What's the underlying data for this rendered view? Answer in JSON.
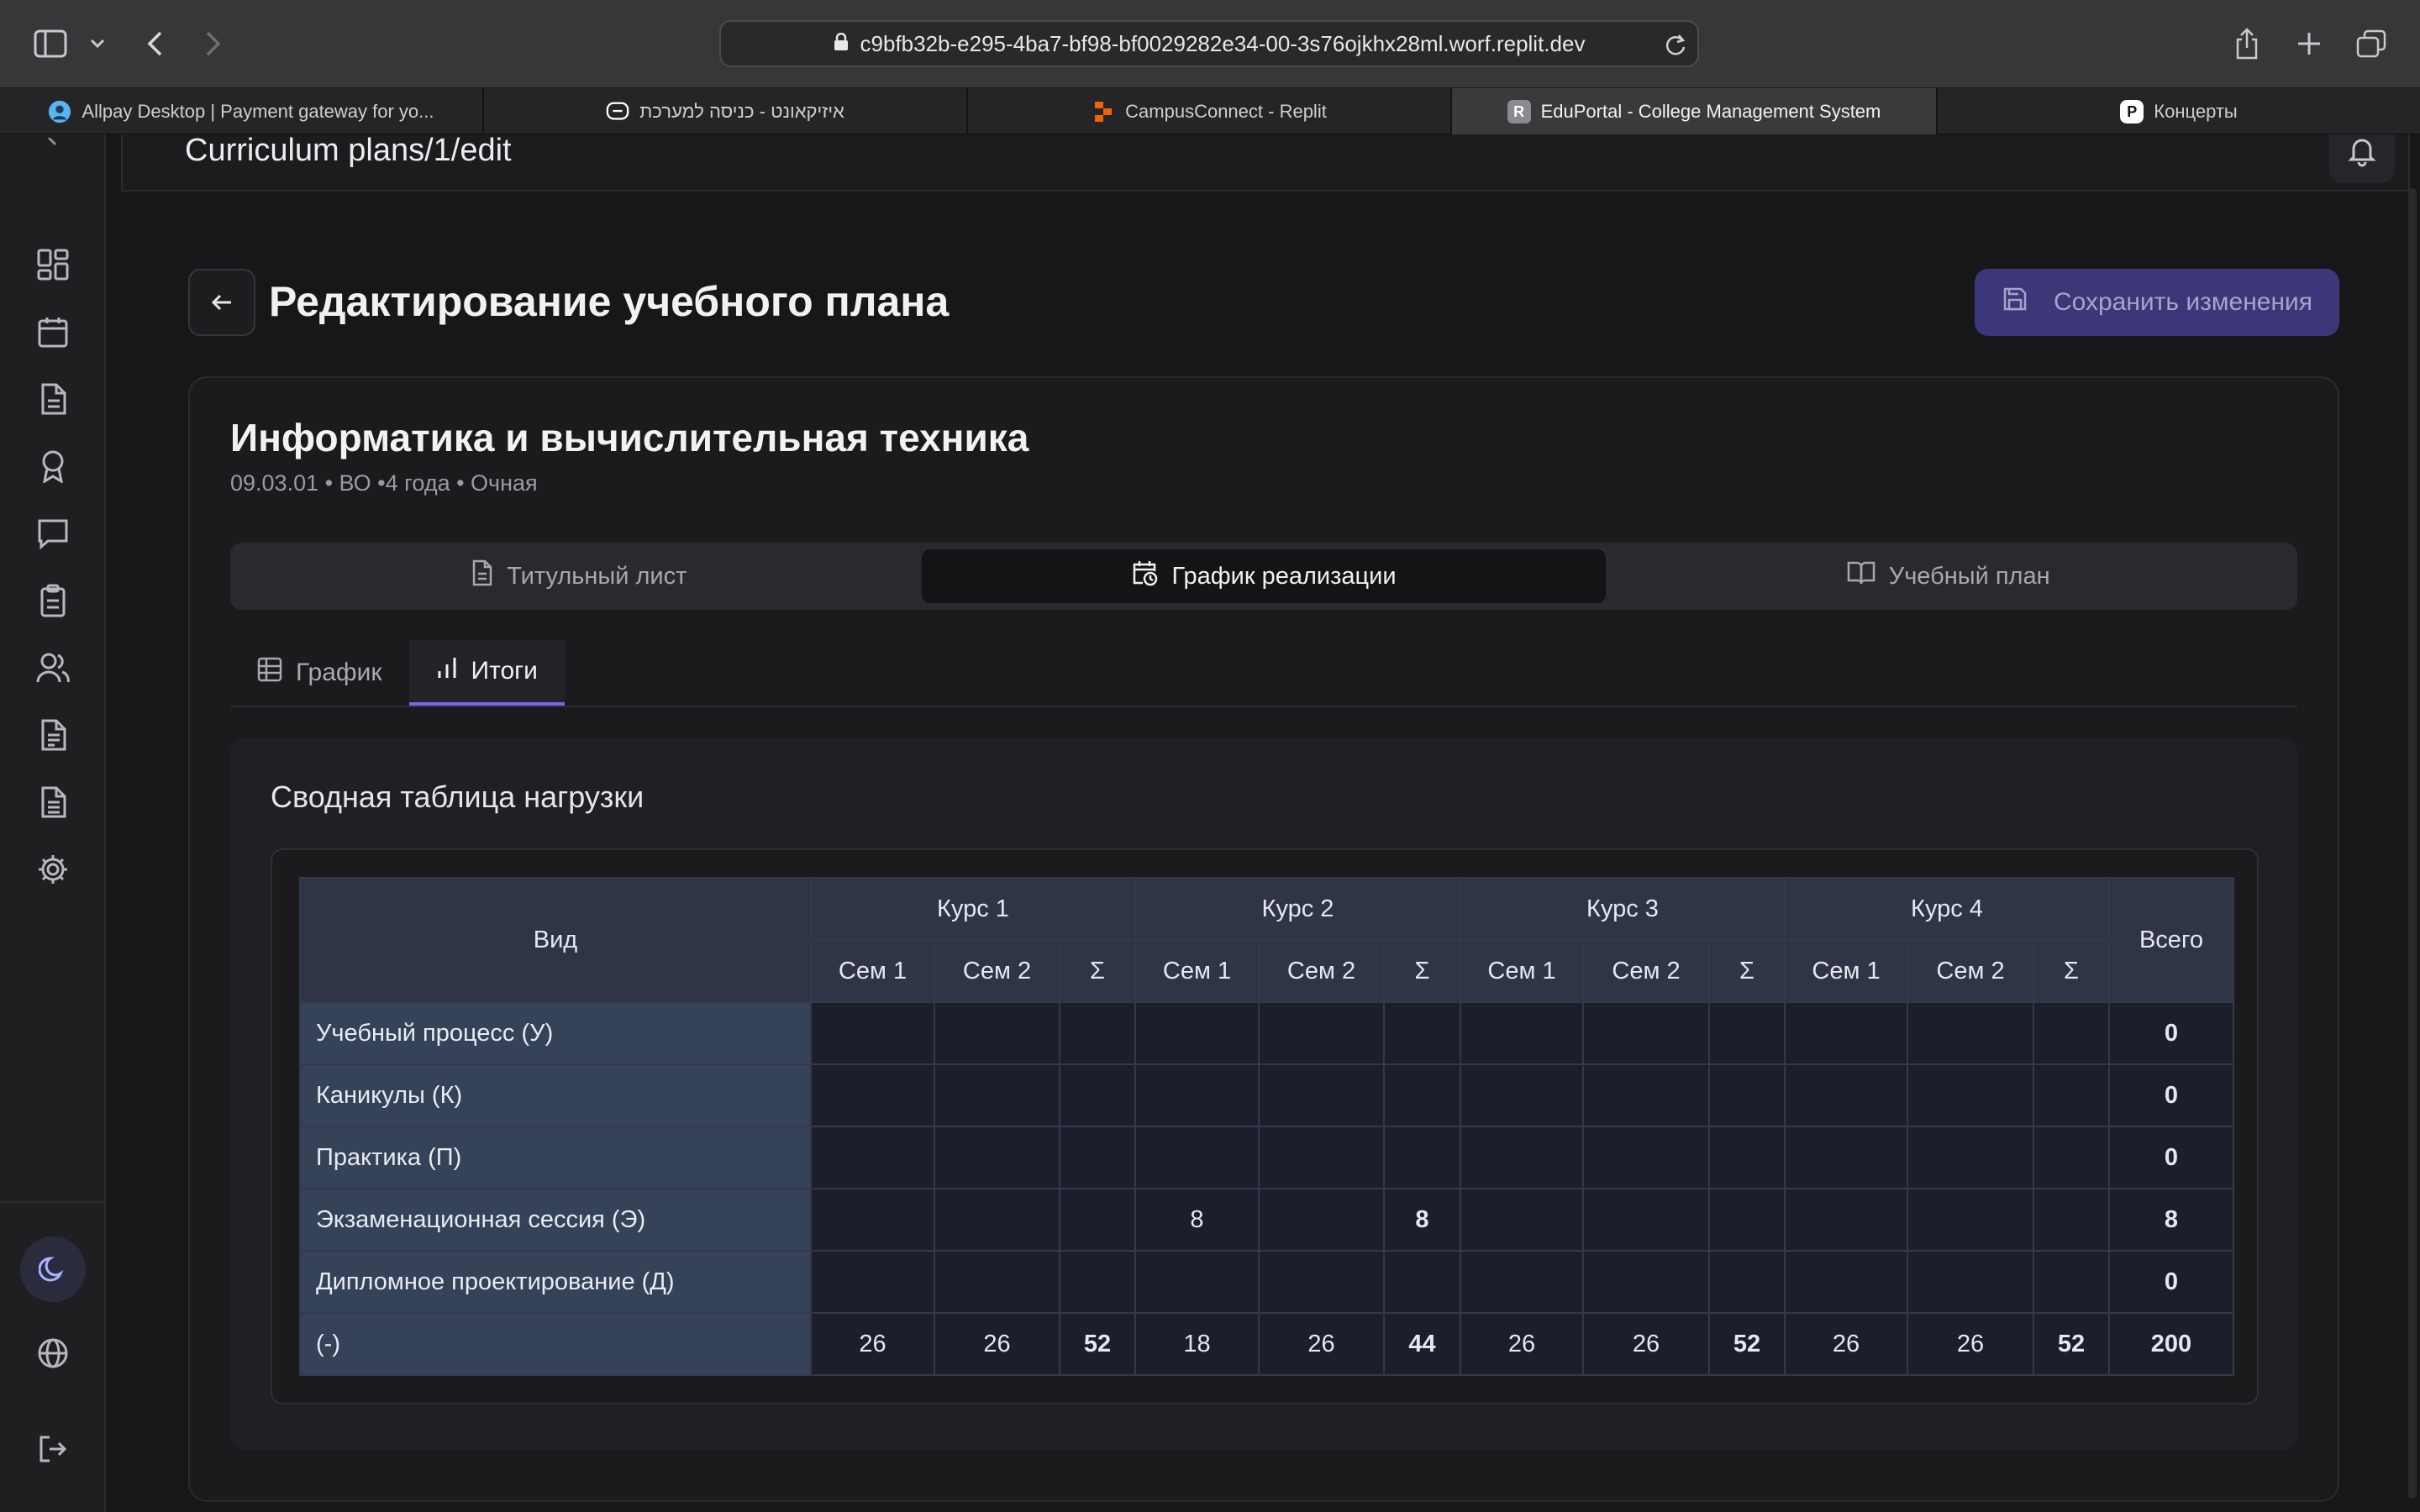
{
  "browser": {
    "url": "c9bfb32b-e295-4ba7-bf98-bf0029282e34-00-3s76ojkhx28ml.worf.replit.dev",
    "tabs": [
      {
        "title": "Allpay Desktop | Payment gateway for yo...",
        "favicon": "user-circle-icon",
        "color": "#5ab4f0"
      },
      {
        "title": "איזיקאונט - כניסה למערכת",
        "favicon": "message-icon",
        "color": "#ffffff"
      },
      {
        "title": "CampusConnect - Replit",
        "favicon": "replit-icon",
        "color": "#f26207"
      },
      {
        "title": "EduPortal - College Management System",
        "favicon": "R",
        "color": "#8a8a92"
      },
      {
        "title": "Концерты",
        "favicon": "P",
        "color": "#ffffff"
      }
    ],
    "active_tab": 3
  },
  "topbar": {
    "breadcrumb": "Curriculum plans/1/edit"
  },
  "header": {
    "title": "Редактирование учебного плана",
    "save_label": "Сохранить изменения"
  },
  "program": {
    "name": "Информатика и вычислительная техника",
    "subtitle": "09.03.01 • ВО •4 года • Очная"
  },
  "main_tabs": [
    {
      "label": "Титульный лист",
      "icon": "file-icon"
    },
    {
      "label": "График реализации",
      "icon": "calendar-clock-icon"
    },
    {
      "label": "Учебный план",
      "icon": "book-open-icon"
    }
  ],
  "sub_tabs": [
    {
      "label": "График",
      "icon": "table-icon"
    },
    {
      "label": "Итоги",
      "icon": "bar-chart-icon"
    }
  ],
  "summary": {
    "title": "Сводная таблица нагрузки",
    "col_type": "Вид",
    "col_total": "Всего",
    "courses": [
      "Курс 1",
      "Курс 2",
      "Курс 3",
      "Курс 4"
    ],
    "sub_cols": [
      "Сем 1",
      "Сем 2",
      "Σ"
    ],
    "rows": [
      {
        "label": "Учебный процесс (У)",
        "values": [
          "",
          "",
          "",
          "",
          "",
          "",
          "",
          "",
          "",
          "",
          "",
          ""
        ],
        "total": "0"
      },
      {
        "label": "Каникулы (К)",
        "values": [
          "",
          "",
          "",
          "",
          "",
          "",
          "",
          "",
          "",
          "",
          "",
          ""
        ],
        "total": "0"
      },
      {
        "label": "Практика (П)",
        "values": [
          "",
          "",
          "",
          "",
          "",
          "",
          "",
          "",
          "",
          "",
          "",
          ""
        ],
        "total": "0"
      },
      {
        "label": "Экзаменационная сессия (Э)",
        "values": [
          "",
          "",
          "",
          "8",
          "",
          "8",
          "",
          "",
          "",
          "",
          "",
          ""
        ],
        "total": "8"
      },
      {
        "label": "Дипломное проектирование (Д)",
        "values": [
          "",
          "",
          "",
          "",
          "",
          "",
          "",
          "",
          "",
          "",
          "",
          ""
        ],
        "total": "0"
      },
      {
        "label": "(-)",
        "values": [
          "26",
          "26",
          "52",
          "18",
          "26",
          "44",
          "26",
          "26",
          "52",
          "26",
          "26",
          "52"
        ],
        "total": "200"
      }
    ]
  },
  "sidebar": {
    "icons": [
      "dashboard-icon",
      "calendar-icon",
      "document-icon",
      "award-icon",
      "chat-icon",
      "clipboard-icon",
      "users-icon",
      "report-icon",
      "file-text-icon",
      "settings-icon"
    ],
    "bottom": [
      "moon-icon",
      "globe-icon",
      "logout-icon"
    ]
  },
  "colors": {
    "accent": "#7367f0",
    "save_bg": "#3b3778"
  }
}
